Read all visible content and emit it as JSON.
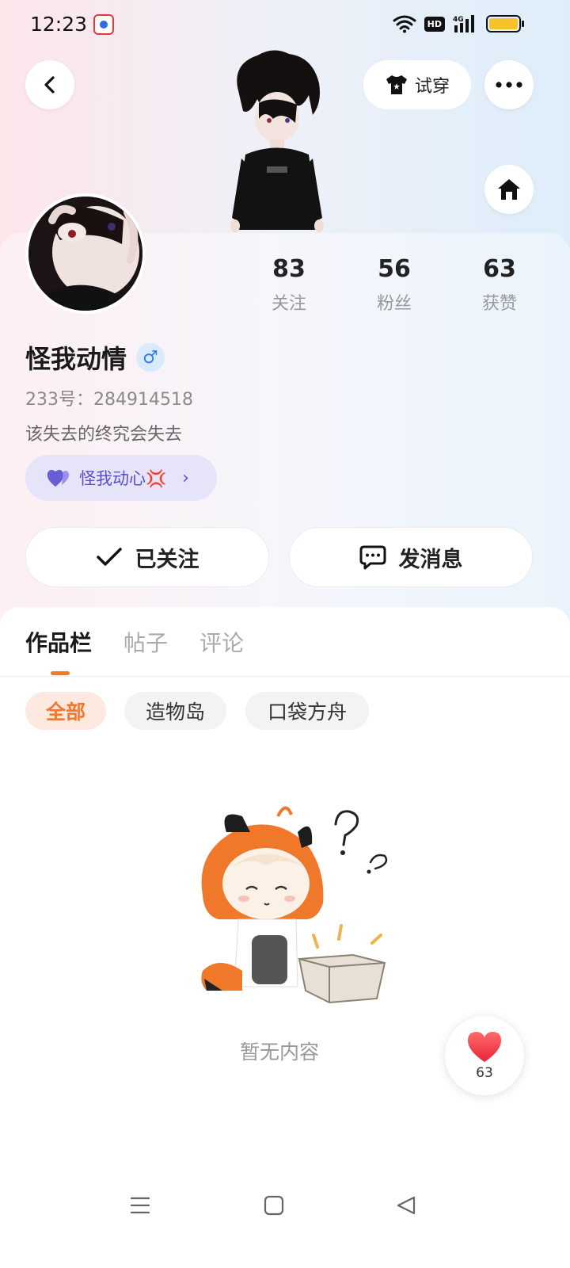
{
  "status_bar": {
    "time": "12:23",
    "app_icon": "baidu-app-icon",
    "hd_label": "HD",
    "network": "4G",
    "battery_color": "#f6c22b"
  },
  "header": {
    "back_icon": "back-arrow-icon",
    "tryon_label": "试穿",
    "tryon_icon": "shirt-icon",
    "more_icon": "more-dots-icon",
    "home_icon": "home-icon"
  },
  "profile": {
    "avatar_icon": "user-avatar",
    "stats": [
      {
        "value": "83",
        "label": "关注"
      },
      {
        "value": "56",
        "label": "粉丝"
      },
      {
        "value": "63",
        "label": "获赞"
      }
    ],
    "username": "怪我动情",
    "gender_icon": "♂",
    "id_line": "233号：284914518",
    "bio": "该失去的终究会失去",
    "signature_chip": {
      "heart_icon": "purple-heart-icon",
      "label": "怪我动心💢",
      "chevron": "›"
    },
    "follow_button": {
      "icon": "check-icon",
      "label": "已关注"
    },
    "message_button": {
      "icon": "chat-bubble-icon",
      "label": "发消息"
    }
  },
  "tabs": [
    {
      "label": "作品栏",
      "active": true
    },
    {
      "label": "帖子",
      "active": false
    },
    {
      "label": "评论",
      "active": false
    }
  ],
  "filters": [
    {
      "label": "全部",
      "active": true
    },
    {
      "label": "造物岛",
      "active": false
    },
    {
      "label": "口袋方舟",
      "active": false
    }
  ],
  "empty_state": {
    "illustration": "confused-girl-empty-box-illustration",
    "text": "暂无内容"
  },
  "like_button": {
    "icon": "red-heart-icon",
    "count": "63"
  },
  "accent_color": "#f37a22",
  "nav_bar": {
    "menu_icon": "menu-icon",
    "home_icon": "square-home-icon",
    "back_icon": "triangle-back-icon"
  }
}
